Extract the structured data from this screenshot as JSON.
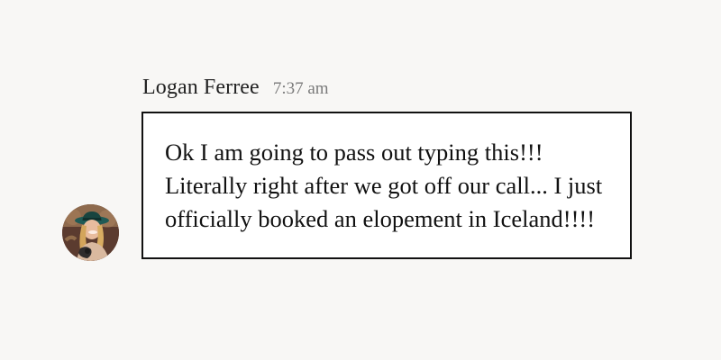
{
  "message": {
    "sender_name": "Logan Ferree",
    "timestamp": "7:37 am",
    "text_lines": [
      "Ok I am going to pass out typing this!!!",
      "Literally right after we got off our call... I just",
      "officially booked an elopement in Iceland!!!!"
    ],
    "avatar_icon": "user-photo-icon"
  },
  "colors": {
    "background": "#f8f7f5",
    "bubble_background": "#ffffff",
    "bubble_border": "#111111",
    "timestamp": "#7a7a7a",
    "avatar_hat": "#1f5a55"
  }
}
